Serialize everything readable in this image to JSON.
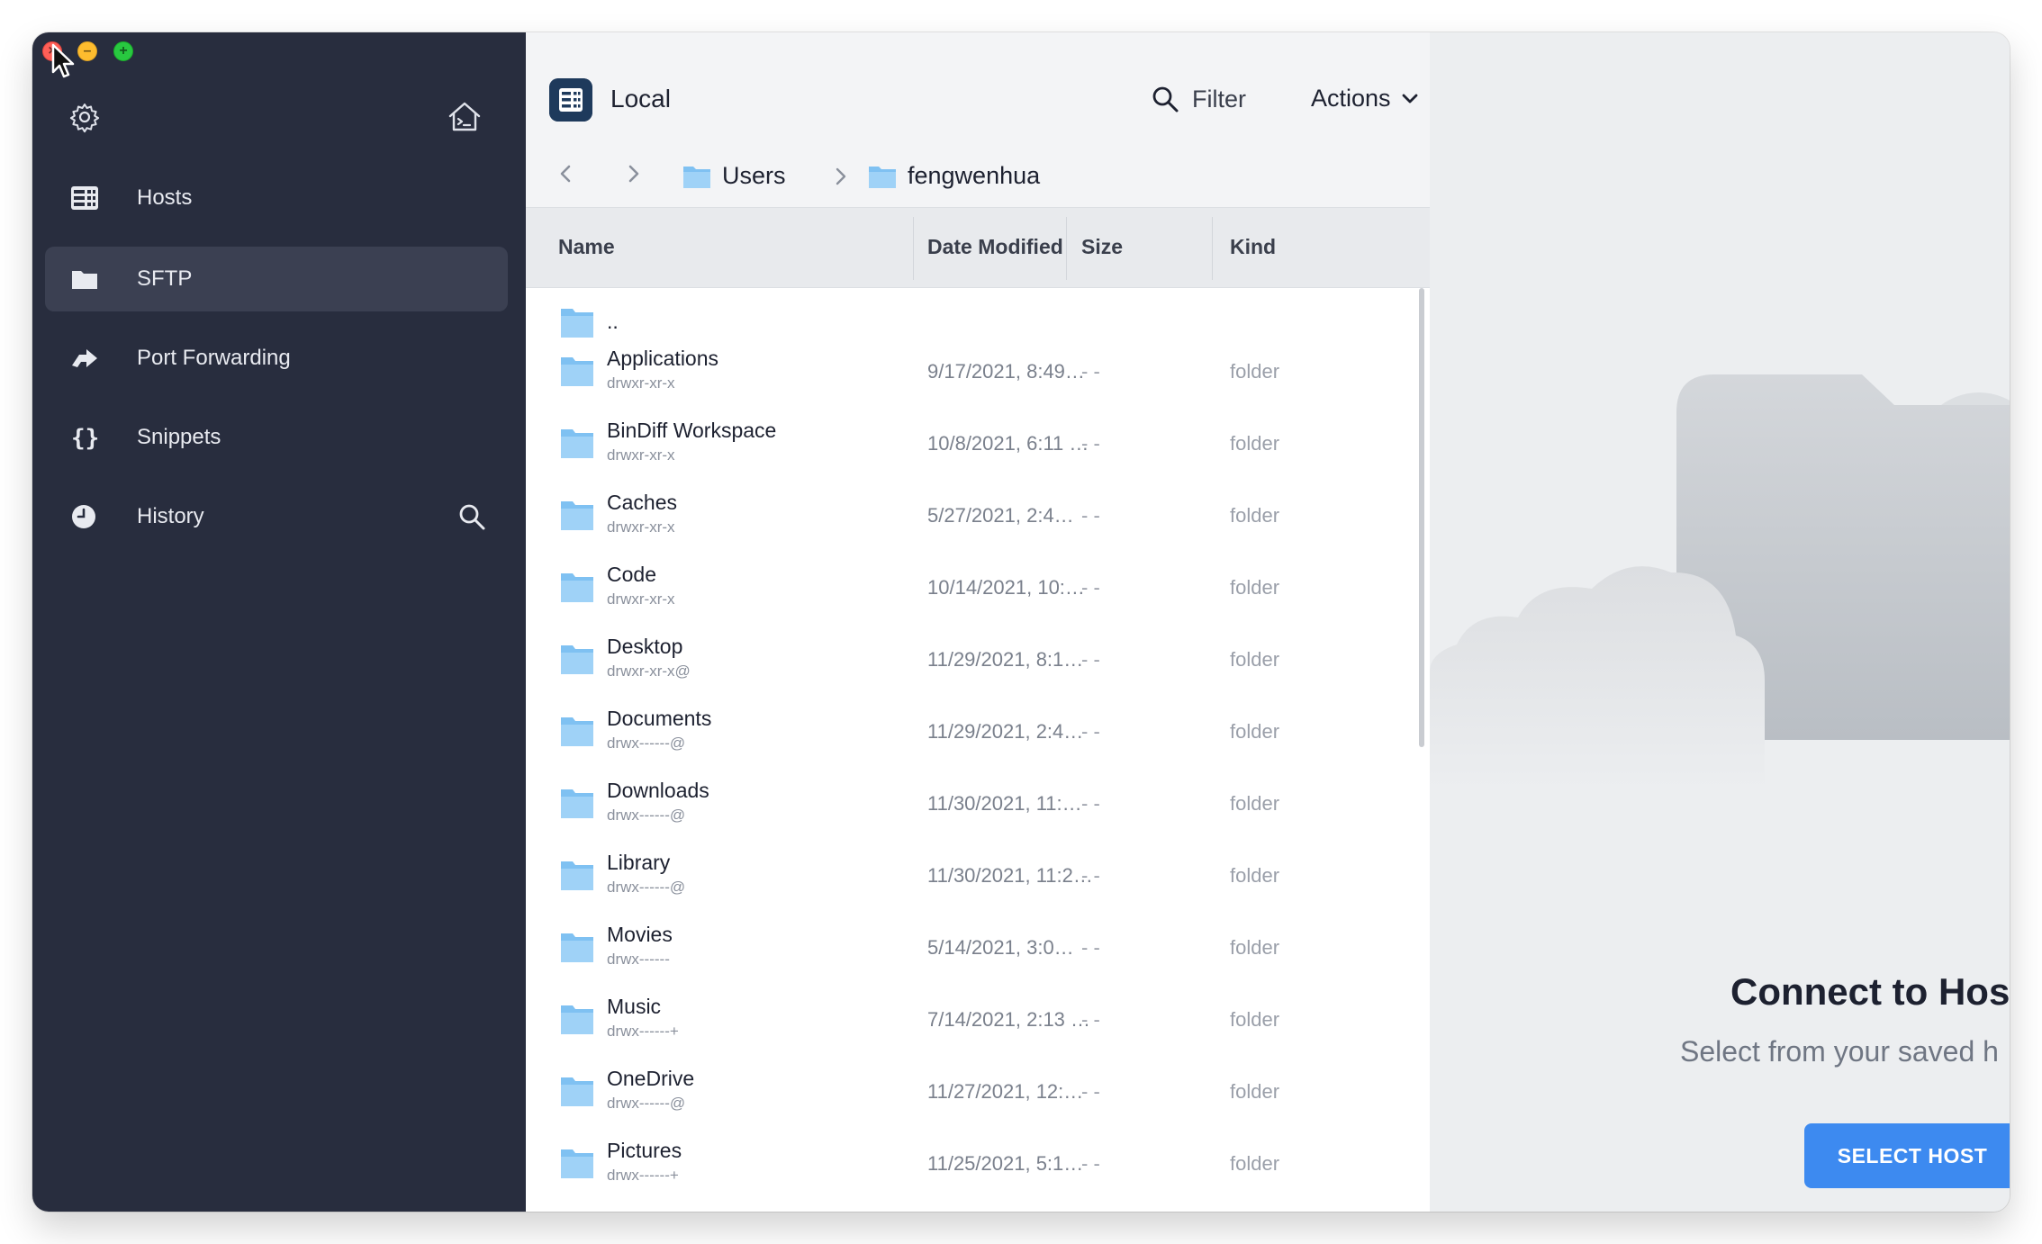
{
  "window": {
    "controls": [
      "close",
      "minimize",
      "maximize"
    ]
  },
  "sidebar": {
    "top_icons": [
      {
        "name": "settings-gear-icon"
      },
      {
        "name": "local-terminal-home-icon"
      }
    ],
    "items": [
      {
        "label": "Hosts",
        "icon": "hosts-grid-icon",
        "active": false
      },
      {
        "label": "SFTP",
        "icon": "folder-icon",
        "active": true
      },
      {
        "label": "Port Forwarding",
        "icon": "port-forwarding-icon",
        "active": false
      },
      {
        "label": "Snippets",
        "icon": "braces-icon",
        "active": false
      },
      {
        "label": "History",
        "icon": "clock-icon",
        "active": false
      }
    ]
  },
  "panel": {
    "title": "Local",
    "filter_label": "Filter",
    "actions_label": "Actions",
    "breadcrumb": [
      "Users",
      "fengwenhua"
    ],
    "columns": [
      "Name",
      "Date Modified",
      "Size",
      "Kind"
    ],
    "parent_label": "..",
    "rows": [
      {
        "name": "Applications",
        "perm": "drwxr-xr-x",
        "date": "9/17/2021, 8:49…",
        "size": "- -",
        "kind": "folder"
      },
      {
        "name": "BinDiff Workspace",
        "perm": "drwxr-xr-x",
        "date": "10/8/2021, 6:11 …",
        "size": "- -",
        "kind": "folder"
      },
      {
        "name": "Caches",
        "perm": "drwxr-xr-x",
        "date": "5/27/2021, 2:4…",
        "size": "- -",
        "kind": "folder"
      },
      {
        "name": "Code",
        "perm": "drwxr-xr-x",
        "date": "10/14/2021, 10:…",
        "size": "- -",
        "kind": "folder"
      },
      {
        "name": "Desktop",
        "perm": "drwxr-xr-x@",
        "date": "11/29/2021, 8:1…",
        "size": "- -",
        "kind": "folder"
      },
      {
        "name": "Documents",
        "perm": "drwx------@",
        "date": "11/29/2021, 2:4…",
        "size": "- -",
        "kind": "folder"
      },
      {
        "name": "Downloads",
        "perm": "drwx------@",
        "date": "11/30/2021, 11:…",
        "size": "- -",
        "kind": "folder"
      },
      {
        "name": "Library",
        "perm": "drwx------@",
        "date": "11/30/2021, 11:2…",
        "size": "- -",
        "kind": "folder"
      },
      {
        "name": "Movies",
        "perm": "drwx------",
        "date": "5/14/2021, 3:0…",
        "size": "- -",
        "kind": "folder"
      },
      {
        "name": "Music",
        "perm": "drwx------+",
        "date": "7/14/2021, 2:13 …",
        "size": "- -",
        "kind": "folder"
      },
      {
        "name": "OneDrive",
        "perm": "drwx------@",
        "date": "11/27/2021, 12:…",
        "size": "- -",
        "kind": "folder"
      },
      {
        "name": "Pictures",
        "perm": "drwx------+",
        "date": "11/25/2021, 5:1…",
        "size": "- -",
        "kind": "folder"
      }
    ]
  },
  "right_panel": {
    "title": "Connect to Hos",
    "subtitle": "Select from your saved h",
    "button_label": "SELECT HOST"
  },
  "colors": {
    "sidebar_bg": "#282d3e",
    "sidebar_active": "#3b4052",
    "accent_button": "#3d8af0",
    "folder": "#7fc1f2"
  }
}
